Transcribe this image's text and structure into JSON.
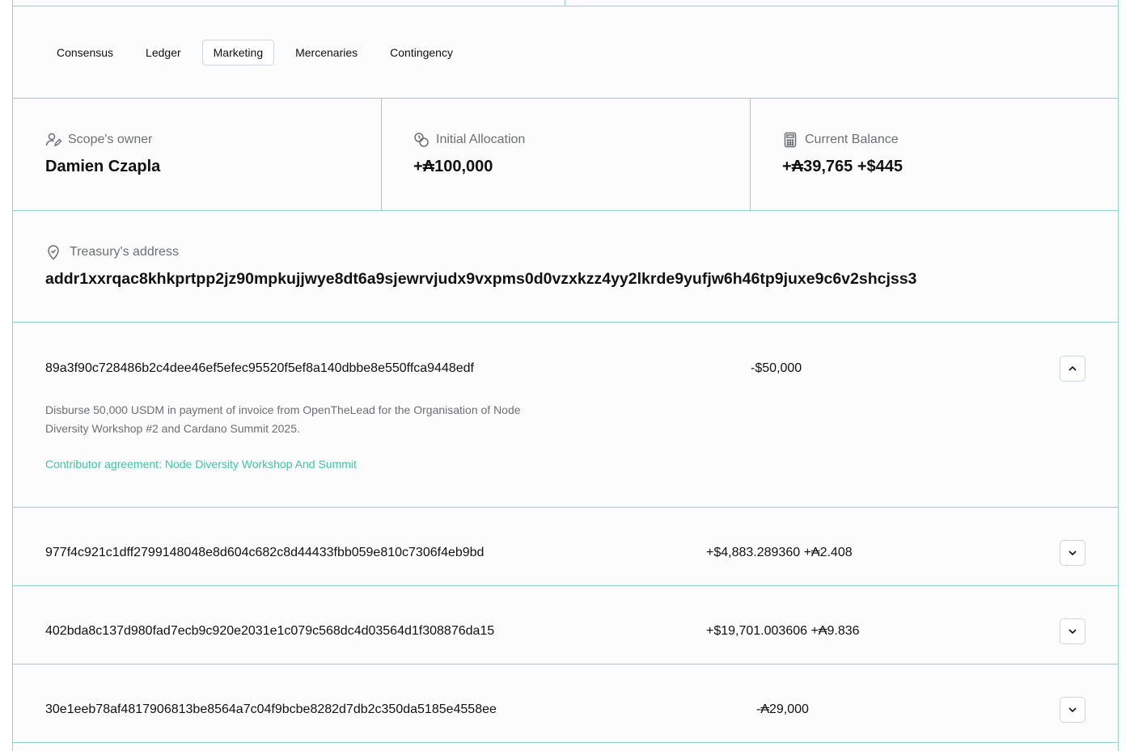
{
  "tabs": [
    "Consensus",
    "Ledger",
    "Marketing",
    "Mercenaries",
    "Contingency"
  ],
  "active_tab": "Marketing",
  "stats": {
    "owner": {
      "label": "Scope's owner",
      "value": "Damien Czapla",
      "icon": "user-edit-icon"
    },
    "allocation": {
      "label": "Initial Allocation",
      "value": "+₳100,000",
      "icon": "coins-icon"
    },
    "balance": {
      "label": "Current Balance",
      "value": "+₳39,765 +$445",
      "icon": "calculator-icon"
    }
  },
  "treasury": {
    "label": "Treasury's address",
    "value": "addr1xxrqac8khkprtpp2jz90mpkujjwye8dt6a9sjewrvjudx9vxpms0d0vzxkzz4yy2lkrde9yufjw6h46tp9juxe9c6v2shcjss3",
    "icon": "map-pin-icon"
  },
  "transactions": [
    {
      "hash": "89a3f90c728486b2c4dee46ef5efec95520f5ef8a140dbbe8e550ffca9448edf",
      "amount": "-$50,000",
      "expanded": true,
      "description": "Disburse 50,000 USDM in payment of invoice from OpenTheLead for the Organisation of Node Diversity Workshop #2 and Cardano Summit 2025.",
      "link": "Contributor agreement: Node Diversity Workshop And Summit"
    },
    {
      "hash": "977f4c921c1dff2799148048e8d604c682c8d44433fbb059e810c7306f4eb9bd",
      "amount": "+$4,883.289360 +₳2.408",
      "expanded": false
    },
    {
      "hash": "402bda8c137d980fad7ecb9c920e2031e1c079c568dc4d03564d1f308876da15",
      "amount": "+$19,701.003606 +₳9.836",
      "expanded": false
    },
    {
      "hash": "30e1eeb78af4817906813be8564a7c04f9bcbe8282d7db2c350da5185e4558ee",
      "amount": "-₳29,000",
      "expanded": false
    }
  ],
  "colors": {
    "accent": "#3fc4a6",
    "border": "#8fd3c7",
    "muted": "#6b6f73"
  }
}
